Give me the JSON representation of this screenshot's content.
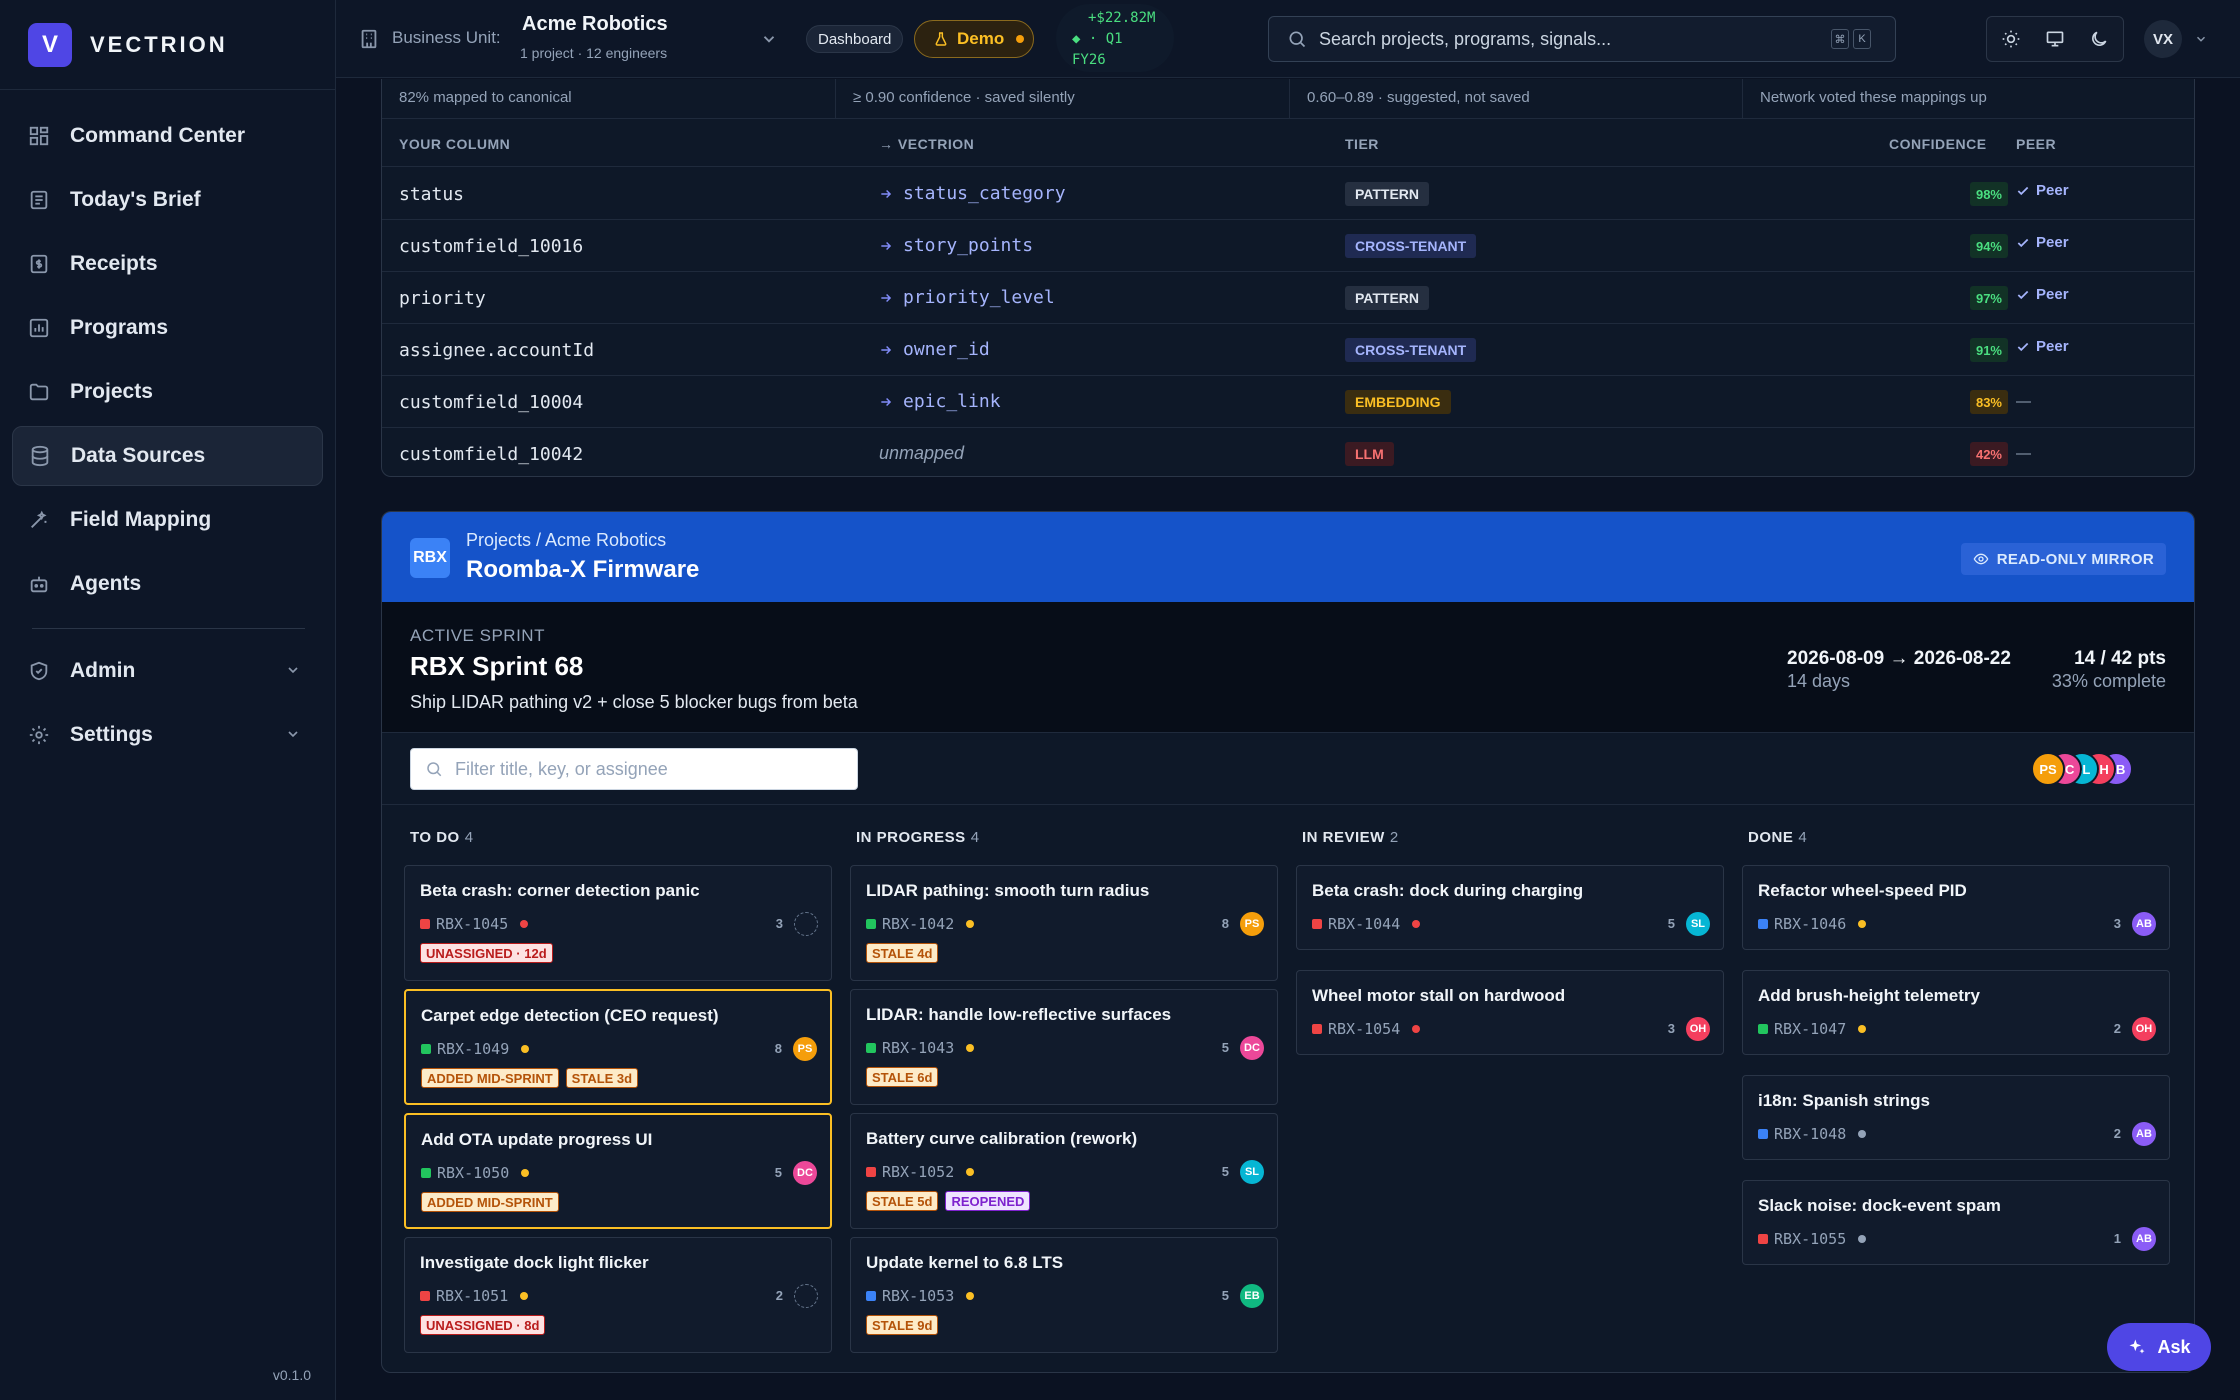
{
  "brand": {
    "logo": "V",
    "name": "VECTRION"
  },
  "sidebar": {
    "items": [
      {
        "label": "Command Center",
        "icon": "grid-icon"
      },
      {
        "label": "Today's Brief",
        "icon": "newspaper-icon"
      },
      {
        "label": "Receipts",
        "icon": "receipt-icon"
      },
      {
        "label": "Programs",
        "icon": "chart-icon"
      },
      {
        "label": "Projects",
        "icon": "folder-icon"
      },
      {
        "label": "Data Sources",
        "icon": "database-icon",
        "active": true
      },
      {
        "label": "Field Mapping",
        "icon": "wand-icon"
      },
      {
        "label": "Agents",
        "icon": "bot-icon"
      }
    ],
    "admin": "Admin",
    "settings": "Settings",
    "version": "v0.1.0"
  },
  "topbar": {
    "bu_label": "Business Unit:",
    "bu_name": "Acme Robotics",
    "bu_sub": "1 project · 12 engineers",
    "dashboard_chip": "Dashboard",
    "demo_chip": "Demo",
    "money_line1": "+$22.82M",
    "money_line2": "· Q1",
    "money_line3": "FY26",
    "search_placeholder": "Search projects, programs, signals...",
    "kbd1": "⌘",
    "kbd2": "K",
    "avatar": "VX"
  },
  "mapping": {
    "stats": [
      "82% mapped to canonical",
      "≥ 0.90 confidence · saved silently",
      "0.60–0.89 · suggested, not saved",
      "Network voted these mappings up"
    ],
    "headers": {
      "column": "YOUR COLUMN",
      "target": "→ VECTRION",
      "tier": "TIER",
      "confidence": "CONFIDENCE",
      "peer": "PEER"
    },
    "rows": [
      {
        "column": "status",
        "target": "status_category",
        "tier": "PATTERN",
        "tier_style": "pattern",
        "confidence": "98%",
        "conf_style": "hi",
        "peer": "Peer"
      },
      {
        "column": "customfield_10016",
        "target": "story_points",
        "tier": "CROSS-TENANT",
        "tier_style": "cross",
        "confidence": "94%",
        "conf_style": "hi",
        "peer": "Peer"
      },
      {
        "column": "priority",
        "target": "priority_level",
        "tier": "PATTERN",
        "tier_style": "pattern",
        "confidence": "97%",
        "conf_style": "hi",
        "peer": "Peer"
      },
      {
        "column": "assignee.accountId",
        "target": "owner_id",
        "tier": "CROSS-TENANT",
        "tier_style": "cross",
        "confidence": "91%",
        "conf_style": "hi",
        "peer": "Peer"
      },
      {
        "column": "customfield_10004",
        "target": "epic_link",
        "tier": "EMBEDDING",
        "tier_style": "embed",
        "confidence": "83%",
        "conf_style": "mid",
        "peer": "—"
      },
      {
        "column": "customfield_10042",
        "target": "unmapped",
        "unmapped": true,
        "tier": "LLM",
        "tier_style": "llm",
        "confidence": "42%",
        "conf_style": "lo",
        "peer": "—"
      }
    ]
  },
  "project": {
    "logo": "RBX",
    "breadcrumb": "Projects / Acme Robotics",
    "title": "Roomba-X Firmware",
    "badge": "READ-ONLY MIRROR",
    "sprint_label": "ACTIVE SPRINT",
    "sprint_name": "RBX Sprint 68",
    "sprint_goal": "Ship LIDAR pathing v2 + close 5 blocker bugs from beta",
    "dates": "2026-08-09 → 2026-08-22",
    "duration": "14 days",
    "points": "14 / 42 pts",
    "complete": "33% complete",
    "filter_placeholder": "Filter title, key, or assignee",
    "team": [
      {
        "initials": "PS",
        "color": "#f59e0b"
      },
      {
        "initials": "DC",
        "color": "#ec4899"
      },
      {
        "initials": "SL",
        "color": "#06b6d4"
      },
      {
        "initials": "OH",
        "color": "#f43f5e"
      },
      {
        "initials": "AB",
        "color": "#8b5cf6"
      }
    ]
  },
  "colors": {
    "bug": "#ef4444",
    "story": "#22c55e",
    "task": "#3b82f6",
    "high": "#ef4444",
    "medium": "#fbbf24",
    "low": "#94a3b8"
  },
  "board": [
    {
      "name": "TO DO",
      "count": "4",
      "cards": [
        {
          "title": "Beta crash: corner detection panic",
          "key": "RBX-1045",
          "type": "bug",
          "prio": "high",
          "points": "3",
          "assignee": "",
          "tags": [
            {
              "text": "UNASSIGNED · 12d",
              "style": "red"
            }
          ]
        },
        {
          "title": "Carpet edge detection (CEO request)",
          "key": "RBX-1049",
          "type": "story",
          "prio": "medium",
          "points": "8",
          "assignee": "PS",
          "highlight": true,
          "tags": [
            {
              "text": "ADDED MID-SPRINT",
              "style": "amber"
            },
            {
              "text": "STALE 3d",
              "style": "amber"
            }
          ]
        },
        {
          "title": "Add OTA update progress UI",
          "key": "RBX-1050",
          "type": "story",
          "prio": "medium",
          "points": "5",
          "assignee": "DC",
          "highlight": true,
          "tags": [
            {
              "text": "ADDED MID-SPRINT",
              "style": "amber"
            }
          ]
        },
        {
          "title": "Investigate dock light flicker",
          "key": "RBX-1051",
          "type": "bug",
          "prio": "medium",
          "points": "2",
          "assignee": "",
          "tags": [
            {
              "text": "UNASSIGNED · 8d",
              "style": "red"
            }
          ]
        }
      ]
    },
    {
      "name": "IN PROGRESS",
      "count": "4",
      "cards": [
        {
          "title": "LIDAR pathing: smooth turn radius",
          "key": "RBX-1042",
          "type": "story",
          "prio": "medium",
          "points": "8",
          "assignee": "PS",
          "tags": [
            {
              "text": "STALE 4d",
              "style": "amber"
            }
          ]
        },
        {
          "title": "LIDAR: handle low-reflective surfaces",
          "key": "RBX-1043",
          "type": "story",
          "prio": "medium",
          "points": "5",
          "assignee": "DC",
          "tags": [
            {
              "text": "STALE 6d",
              "style": "amber"
            }
          ]
        },
        {
          "title": "Battery curve calibration (rework)",
          "key": "RBX-1052",
          "type": "bug",
          "prio": "medium",
          "points": "5",
          "assignee": "SL",
          "tags": [
            {
              "text": "STALE 5d",
              "style": "amber"
            },
            {
              "text": "REOPENED",
              "style": "purple"
            }
          ]
        },
        {
          "title": "Update kernel to 6.8 LTS",
          "key": "RBX-1053",
          "type": "task",
          "prio": "medium",
          "points": "5",
          "assignee": "EB",
          "tags": [
            {
              "text": "STALE 9d",
              "style": "amber"
            }
          ]
        }
      ]
    },
    {
      "name": "IN REVIEW",
      "count": "2",
      "cards": [
        {
          "title": "Beta crash: dock during charging",
          "key": "RBX-1044",
          "type": "bug",
          "prio": "high",
          "points": "5",
          "assignee": "SL",
          "tags": []
        },
        {
          "title": "Wheel motor stall on hardwood",
          "key": "RBX-1054",
          "type": "bug",
          "prio": "high",
          "points": "3",
          "assignee": "OH",
          "tags": []
        }
      ]
    },
    {
      "name": "DONE",
      "count": "4",
      "cards": [
        {
          "title": "Refactor wheel-speed PID",
          "key": "RBX-1046",
          "type": "task",
          "prio": "medium",
          "points": "3",
          "assignee": "AB",
          "tags": []
        },
        {
          "title": "Add brush-height telemetry",
          "key": "RBX-1047",
          "type": "story",
          "prio": "medium",
          "points": "2",
          "assignee": "OH",
          "tags": []
        },
        {
          "title": "i18n: Spanish strings",
          "key": "RBX-1048",
          "type": "task",
          "prio": "low",
          "points": "2",
          "assignee": "AB",
          "tags": []
        },
        {
          "title": "Slack noise: dock-event spam",
          "key": "RBX-1055",
          "type": "bug",
          "prio": "low",
          "points": "1",
          "assignee": "AB",
          "tags": []
        }
      ]
    }
  ],
  "avatar_colors": {
    "PS": "#f59e0b",
    "DC": "#ec4899",
    "SL": "#06b6d4",
    "OH": "#f43f5e",
    "AB": "#8b5cf6",
    "EB": "#10b981"
  },
  "ask_label": "Ask"
}
